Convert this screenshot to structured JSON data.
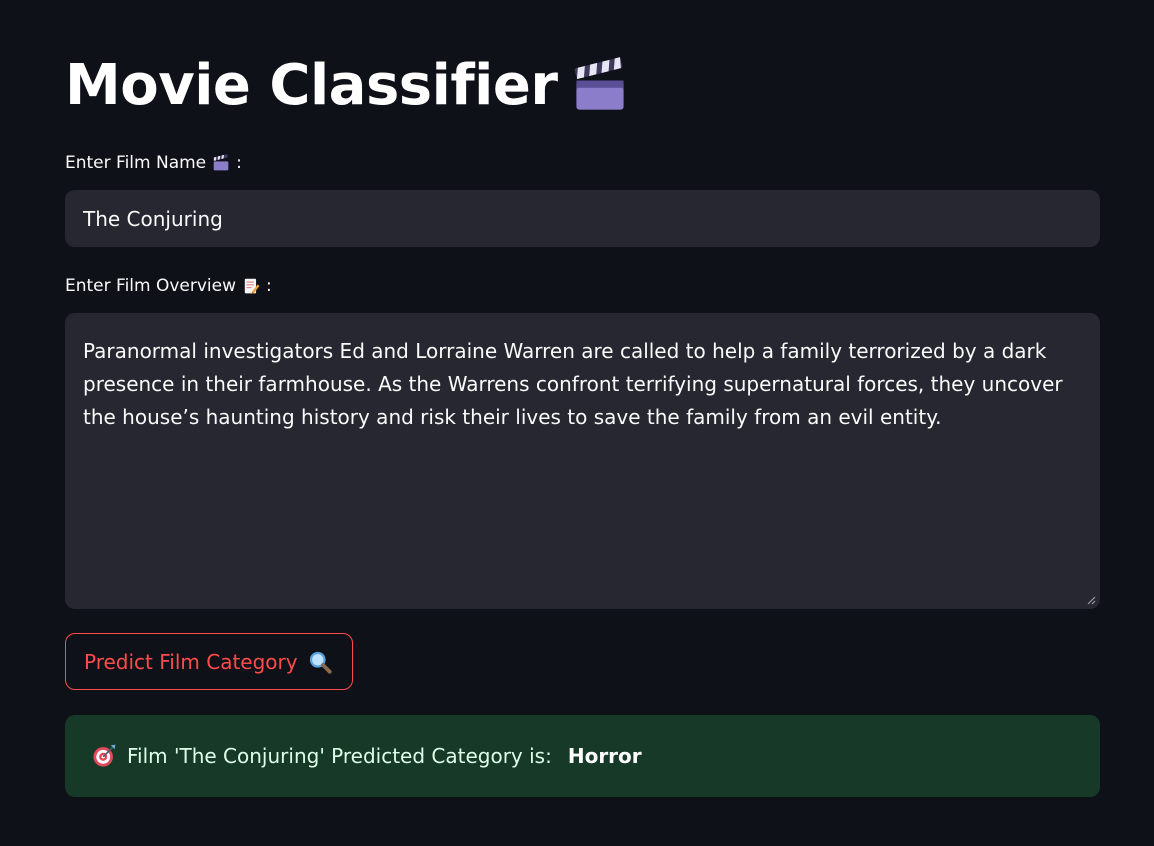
{
  "page": {
    "title": "Movie Classifier",
    "title_icon": "clapper-board-icon"
  },
  "film_name": {
    "label": "Enter Film Name",
    "label_icon": "clapper-board-icon",
    "label_suffix": ":",
    "value": "The Conjuring"
  },
  "film_overview": {
    "label": "Enter Film Overview",
    "label_icon": "memo-icon",
    "label_suffix": ":",
    "value": "Paranormal investigators Ed and Lorraine Warren are called to help a family terrorized by a dark presence in their farmhouse. As the Warrens confront terrifying supernatural forces, they uncover the house’s haunting history and risk their lives to save the family from an evil entity."
  },
  "predict_button": {
    "label": "Predict Film Category",
    "icon": "magnifying-glass-icon"
  },
  "result": {
    "icon": "target-icon",
    "prefix": "Film 'The Conjuring' Predicted Category is:",
    "category": "Horror"
  },
  "colors": {
    "background": "#0e1117",
    "input_bg": "#262730",
    "accent": "#ff4b4b",
    "success_bg": "#173928"
  }
}
